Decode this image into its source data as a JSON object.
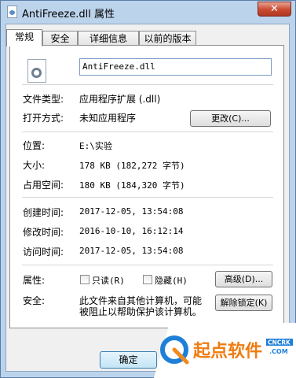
{
  "window": {
    "title": "AntiFreeze.dll 属性",
    "close_label": "✕"
  },
  "tabs": [
    {
      "label": "常规"
    },
    {
      "label": "安全"
    },
    {
      "label": "详细信息"
    },
    {
      "label": "以前的版本"
    }
  ],
  "general": {
    "file_name": "AntiFreeze.dll",
    "file_type_label": "文件类型:",
    "file_type_value": "应用程序扩展 (.dll)",
    "opens_with_label": "打开方式:",
    "opens_with_value": "未知应用程序",
    "change_button": "更改(C)...",
    "location_label": "位置:",
    "location_value": "E:\\实验",
    "size_label": "大小:",
    "size_value": "178 KB (182,272 字节)",
    "size_on_disk_label": "占用空间:",
    "size_on_disk_value": "180 KB (184,320 字节)",
    "created_label": "创建时间:",
    "created_value": "2017-12-05, 13:54:08",
    "modified_label": "修改时间:",
    "modified_value": "2016-10-10, 16:12:14",
    "accessed_label": "访问时间:",
    "accessed_value": "2017-12-05, 13:54:08",
    "attributes_label": "属性:",
    "readonly_label": "只读(R)",
    "readonly_checked": false,
    "hidden_label": "隐藏(H)",
    "hidden_checked": false,
    "advanced_button": "高级(D)...",
    "security_label": "安全:",
    "security_text_line1": "此文件来自其他计算机，可能",
    "security_text_line2": "被阻止以帮助保护该计算机。",
    "unblock_button": "解除锁定(K)"
  },
  "footer": {
    "ok_button": "确定"
  },
  "watermark": {
    "text": "起点软件",
    "sub_top": "CNCRK",
    "sub_bottom": ".COM"
  }
}
